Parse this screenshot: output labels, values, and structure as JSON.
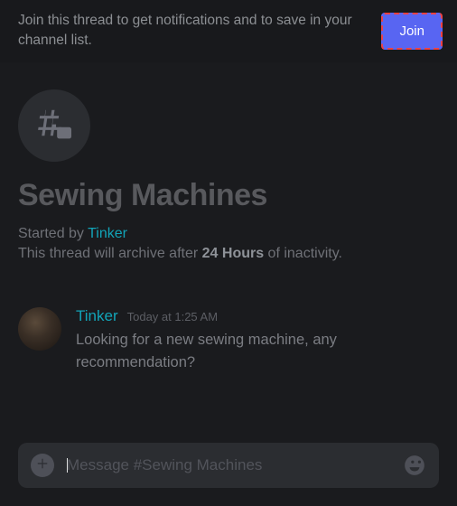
{
  "notice": {
    "text": "Join this thread to get notifications and to save in your channel list.",
    "join_label": "Join"
  },
  "thread": {
    "title": "Sewing Machines",
    "started_by_prefix": "Started by ",
    "starter_user": "Tinker",
    "archive_prefix": "This thread will archive after ",
    "archive_duration": "24 Hours",
    "archive_suffix": " of inactivity."
  },
  "message": {
    "author": "Tinker",
    "timestamp": "Today at 1:25 AM",
    "text": "Looking for a new sewing machine, any recommendation?"
  },
  "composer": {
    "placeholder": "Message #Sewing Machines"
  }
}
